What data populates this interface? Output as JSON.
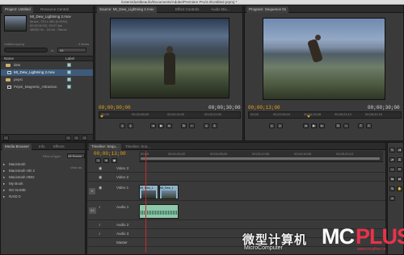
{
  "window": {
    "title": "/Users/dustibeaufo/Documents/Adobe/Premiere Pro/4.0/Untitled.prproj *"
  },
  "project": {
    "tabs": [
      "Project: Untitled",
      "Resource Central"
    ],
    "clip_name": "Mt_Dew_Lightning 2.mov",
    "clip_info": [
      "Movie, 720 x 480 (0.9091)",
      "00:00:30:03, 29.97 fps",
      "48000 Hz - 16-bit - Stereo"
    ],
    "project_file": "Untitled.prproj",
    "item_count": "4 Items",
    "in_label": "In:",
    "in_value": "All",
    "col_name": "Name",
    "col_label": "Label",
    "items": [
      "dew",
      "Mt_Dew_Lightning 2.mov",
      "pepsi",
      "Pepsi_Magnetic_Attraction"
    ]
  },
  "media_browser": {
    "tabs": [
      "Media Browser",
      "Info",
      "Effects"
    ],
    "files_of_type_label": "Files of type:",
    "files_of_type_value": "All Suppo",
    "view_as_label": "View as:",
    "drives": [
      "Macintosh",
      "Macintosh HD 2",
      "Macintosh HDD",
      "My Book",
      "NO NAME",
      "RAID 0"
    ]
  },
  "source_monitor": {
    "tabs": [
      "Source: Mt_Dew_Lightning 2.mov",
      "Effect Controls",
      "Audio Mix..."
    ],
    "timecode_in": "00;00;00;00",
    "timecode_dur": "00;00;30;00",
    "ruler": [
      "00;00",
      "00;00;08;00",
      "00;00;16;00",
      "00;00;24;00"
    ]
  },
  "program_monitor": {
    "tabs": [
      "Program: Sequence 01"
    ],
    "timecode_in": "00;00;13;00",
    "timecode_dur": "00;00;30;00",
    "ruler": [
      "00;00",
      "00;02;08;04",
      "00;04;16;08",
      "00;06;24;12",
      "00;08;32;16"
    ]
  },
  "timeline": {
    "tabs": [
      "Timeline: Sequ...",
      "Timeline: Sca..."
    ],
    "timecode": "00;00;13;00",
    "ruler": [
      "00;00",
      "00;01;04;02",
      "00;02;08;04",
      "00;03;12;06",
      "00;04;16;08",
      "00;05;20;10"
    ],
    "tracks": [
      "Video 3",
      "Video 2",
      "Video 1",
      "Audio 1",
      "Audio 2",
      "Audio 3",
      "Master"
    ],
    "track_flags": [
      "V",
      "A1"
    ],
    "clips": [
      "Mt_Dew_L",
      "Mt_Dew_L"
    ]
  },
  "watermark": {
    "chinese": "微型计算机",
    "latin": "MicroComputer",
    "logo": "MC",
    "logo2": "PLUS",
    "url": "www.mcplive.cn"
  },
  "colors": {
    "accent": "#e8a218",
    "clip_video": "#8fb3c6",
    "clip_audio": "#8fc7aa",
    "playhead": "#c12b2b"
  }
}
